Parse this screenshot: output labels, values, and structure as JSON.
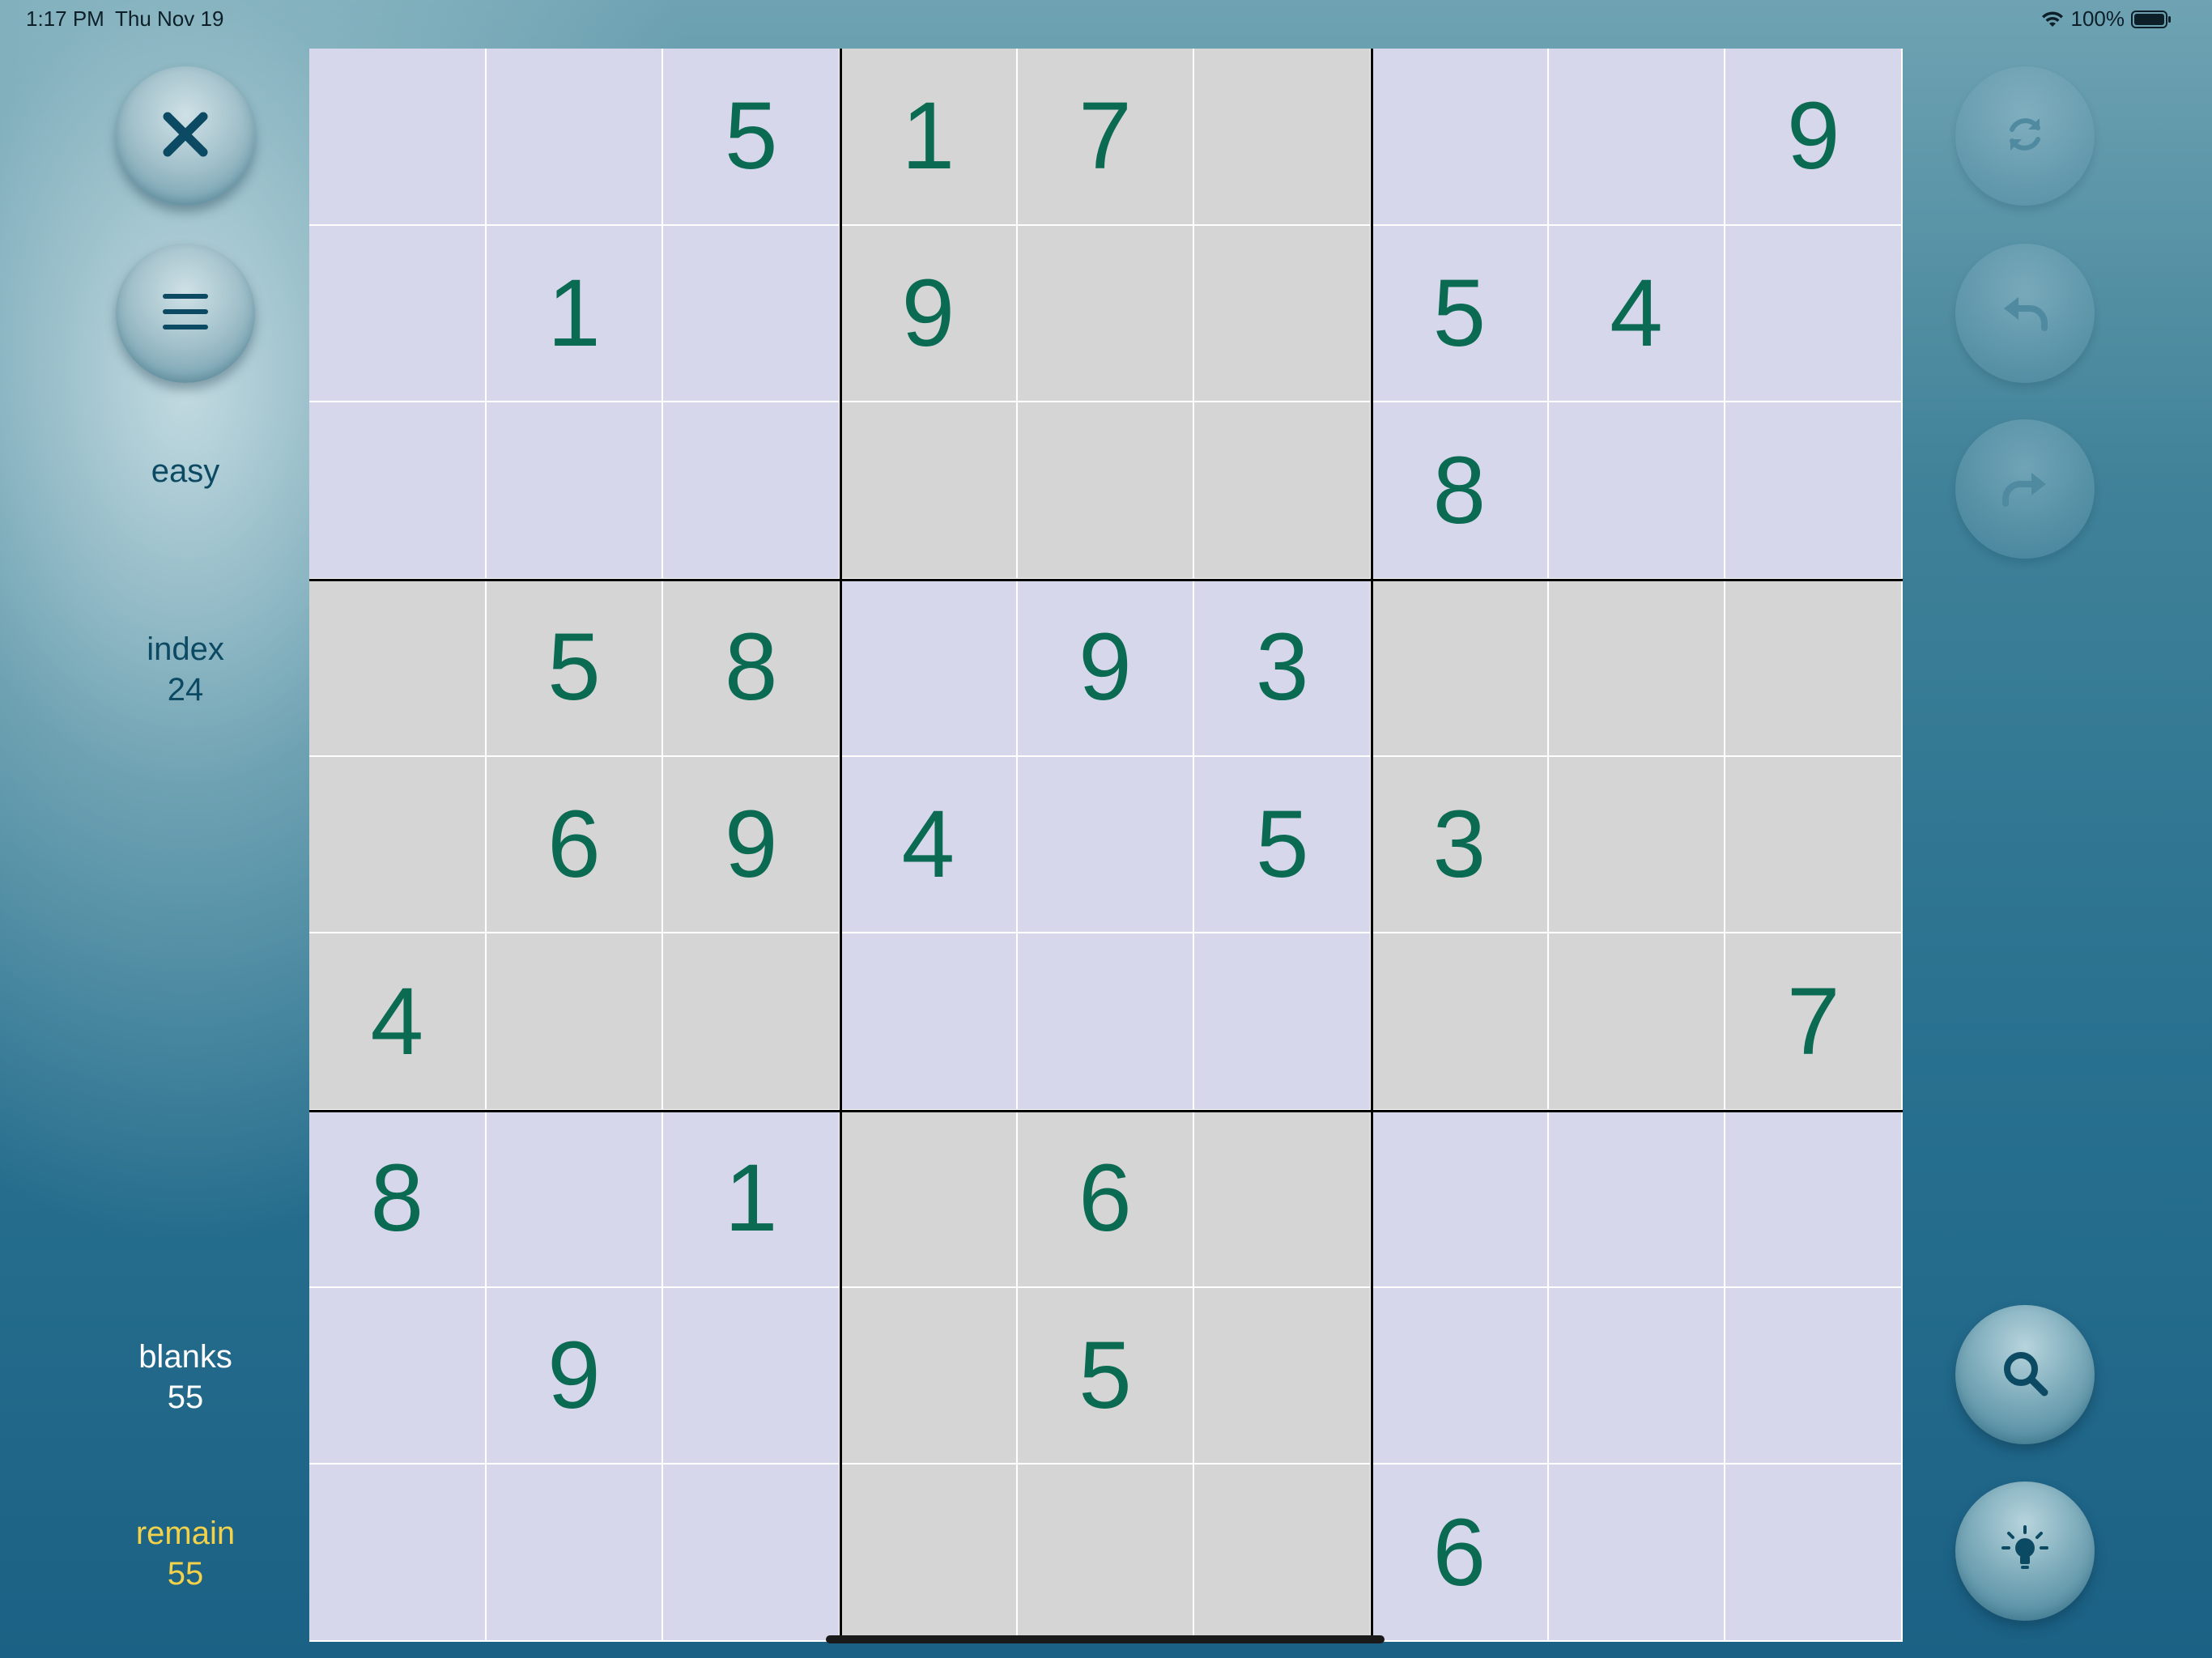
{
  "status_bar": {
    "time": "1:17 PM",
    "date": "Thu Nov 19",
    "battery": "100%"
  },
  "left_panel": {
    "close_icon": "close-icon",
    "menu_icon": "hamburger-menu-icon",
    "difficulty": "easy",
    "index_label": "index",
    "index_value": "24",
    "blanks_label": "blanks",
    "blanks_value": "55",
    "remain_label": "remain",
    "remain_value": "55"
  },
  "right_panel": {
    "refresh_icon": "refresh-icon",
    "undo_icon": "undo-icon",
    "redo_icon": "redo-icon",
    "search_icon": "search-icon",
    "hint_icon": "lightbulb-icon"
  },
  "colors": {
    "cell_light": "#d7d7ec",
    "cell_gray": "#d5d5d5",
    "digit": "#0b6a52",
    "text_teal": "#0c4a63",
    "remain_yellow": "#f2d24a"
  },
  "board": {
    "grid": [
      [
        "",
        "",
        "5",
        "1",
        "7",
        "",
        "",
        "",
        "9"
      ],
      [
        "",
        "1",
        "",
        "9",
        "",
        "",
        "5",
        "4",
        ""
      ],
      [
        "",
        "",
        "",
        "",
        "",
        "",
        "8",
        "",
        ""
      ],
      [
        "",
        "5",
        "8",
        "",
        "9",
        "3",
        "",
        "",
        ""
      ],
      [
        "",
        "6",
        "9",
        "4",
        "",
        "5",
        "3",
        "",
        ""
      ],
      [
        "4",
        "",
        "",
        "",
        "",
        "",
        "",
        "",
        "7"
      ],
      [
        "8",
        "",
        "1",
        "",
        "6",
        "",
        "",
        "",
        ""
      ],
      [
        "",
        "9",
        "",
        "",
        "5",
        "",
        "",
        "",
        ""
      ],
      [
        "",
        "",
        "",
        "",
        "",
        "",
        "6",
        "",
        ""
      ]
    ]
  }
}
